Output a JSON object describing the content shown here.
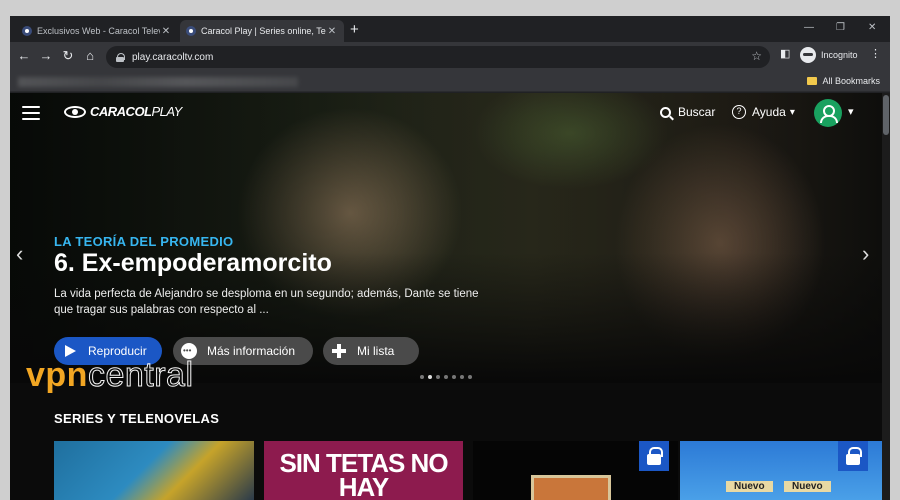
{
  "browser": {
    "tabs": [
      {
        "title": "Exclusivos Web - Caracol Televisi"
      },
      {
        "title": "Caracol Play | Series online, Tele"
      }
    ],
    "new_tab": "+",
    "window_controls": {
      "minimize": "—",
      "maximize": "❐",
      "close": "✕"
    },
    "nav": {
      "back": "←",
      "forward": "→",
      "reload": "↻",
      "home": "⌂"
    },
    "url": "play.caracoltv.com",
    "profile_label": "Incognito",
    "bookmarks_label": "All Bookmarks"
  },
  "site": {
    "logo_bold": "CARACOL",
    "logo_light": "PLAY",
    "search_label": "Buscar",
    "help_label": "Ayuda",
    "help_glyph": "?",
    "caret": "▾"
  },
  "hero": {
    "kicker": "LA TEORÍA DEL PROMEDIO",
    "title": "6. Ex-empoderamorcito",
    "description": "La vida perfecta de Alejandro se desploma en un segundo; además, Dante se tiene que tragar sus palabras con respecto al ...",
    "prev_arrow": "‹",
    "next_arrow": "›",
    "buttons": {
      "play": "Reproducir",
      "info": "Más información",
      "list": "Mi lista"
    },
    "slide_count": 7,
    "active_slide": 1
  },
  "watermark": {
    "part1": "vpn",
    "part2": "central"
  },
  "section": {
    "title": "SERIES Y TELENOVELAS",
    "cards": [
      {
        "title": ""
      },
      {
        "title": "SIN TETAS NO HAY"
      },
      {
        "title": "",
        "locked": true
      },
      {
        "title": "",
        "badge1": "Nuevo",
        "badge2": "Nuevo",
        "locked": true
      }
    ]
  }
}
